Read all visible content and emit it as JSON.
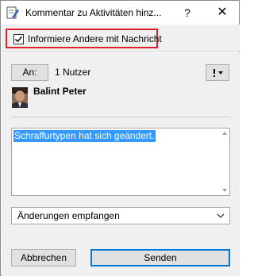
{
  "window": {
    "title": "Kommentar zu Aktivitäten hinz...",
    "help_label": "?",
    "close_label": "✕",
    "app_icon": "edit-document-icon"
  },
  "notify": {
    "label": "Informiere Andere mit Nachricht",
    "checked": true,
    "highlight_color": "#e0212b"
  },
  "recipients": {
    "to_button_label": "An:",
    "count_label": "1 Nutzer",
    "options_icon": "exclamation-dropdown-icon",
    "user_name": "Balint Peter"
  },
  "comment": {
    "text": "Schraffurtypen hat sich geändert.",
    "selection_color": "#3399ff"
  },
  "type_select": {
    "selected": "Änderungen empfangen"
  },
  "footer": {
    "cancel_label": "Abbrechen",
    "send_label": "Senden",
    "default_button_border": "#0078d7"
  }
}
